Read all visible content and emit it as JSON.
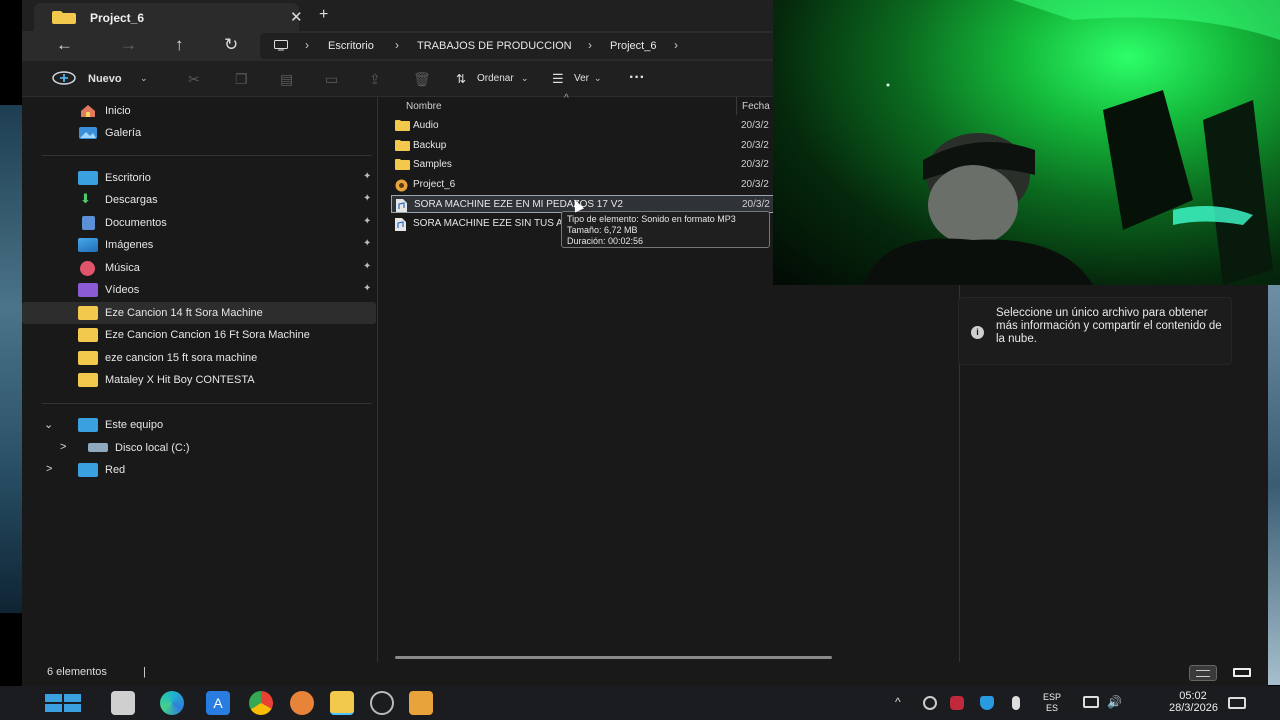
{
  "window": {
    "tab_title": "Project_6",
    "tab_close": "✕",
    "tab_add": "+"
  },
  "navbar": {
    "back": "←",
    "forward": "→",
    "up": "↑",
    "refresh": "↻",
    "breadcrumbs": [
      "Escritorio",
      "TRABAJOS DE PRODUCCION",
      "Project_6"
    ]
  },
  "toolbar": {
    "new_label": "Nuevo",
    "sort_label": "Ordenar",
    "view_label": "Ver",
    "more_label": "···"
  },
  "sidebar": {
    "top": [
      {
        "label": "Inicio",
        "icon": "home-icon"
      },
      {
        "label": "Galería",
        "icon": "gallery-icon"
      }
    ],
    "pinned": [
      {
        "label": "Escritorio",
        "icon": "desktop-icon",
        "pin": "📌"
      },
      {
        "label": "Descargas",
        "icon": "download-icon",
        "pin": "📌"
      },
      {
        "label": "Documentos",
        "icon": "document-icon",
        "pin": "📌"
      },
      {
        "label": "Imágenes",
        "icon": "image-icon",
        "pin": "📌"
      },
      {
        "label": "Música",
        "icon": "music-icon",
        "pin": "📌"
      },
      {
        "label": "Vídeos",
        "icon": "video-icon",
        "pin": "📌"
      }
    ],
    "recent": [
      {
        "label": "Eze Cancion 14 ft Sora Machine",
        "selected": true
      },
      {
        "label": "Eze Cancion Cancion 16 Ft Sora Machine"
      },
      {
        "label": "eze cancion 15 ft sora machine"
      },
      {
        "label": "Mataley X Hit Boy CONTESTA"
      }
    ],
    "tree": [
      {
        "label": "Este equipo",
        "chevron": "⌄"
      },
      {
        "label": "Disco local (C:)",
        "chevron": ">"
      },
      {
        "label": "Red",
        "chevron": ">"
      }
    ]
  },
  "files": {
    "col_name": "Nombre",
    "col_date": "Fecha d",
    "sort_caret": "^",
    "rows": [
      {
        "name": "Audio",
        "date": "20/3/2",
        "type": "folder"
      },
      {
        "name": "Backup",
        "date": "20/3/2",
        "type": "folder"
      },
      {
        "name": "Samples",
        "date": "20/3/2",
        "type": "folder"
      },
      {
        "name": "Project_6",
        "date": "20/3/2",
        "type": "project"
      },
      {
        "name": "SORA MACHINE EZE EN MI PEDAZOS 17 V2",
        "date": "20/3/2",
        "type": "audio",
        "selected": true
      },
      {
        "name": "SORA MACHINE EZE SIN TUS AL",
        "date": "",
        "type": "audio"
      }
    ]
  },
  "tooltip": {
    "type": "Tipo de elemento: Sonido en formato MP3",
    "size": "Tamaño: 6,72 MB",
    "duration": "Duración: 00:02:56"
  },
  "details": {
    "icon": "i",
    "message": "Seleccione un único archivo para obtener más información y compartir el contenido de la nube."
  },
  "status": {
    "count": "6 elementos",
    "cursor": "|"
  },
  "taskbar": {
    "tray_arrow": "^",
    "lang_top": "ESP",
    "lang_bottom": "ES",
    "time": "05:02",
    "date": "28/3/2026"
  },
  "colors": {
    "folder": "#f2c94c",
    "accent": "#4cc2ff",
    "webcam_green": "#14b83a"
  }
}
